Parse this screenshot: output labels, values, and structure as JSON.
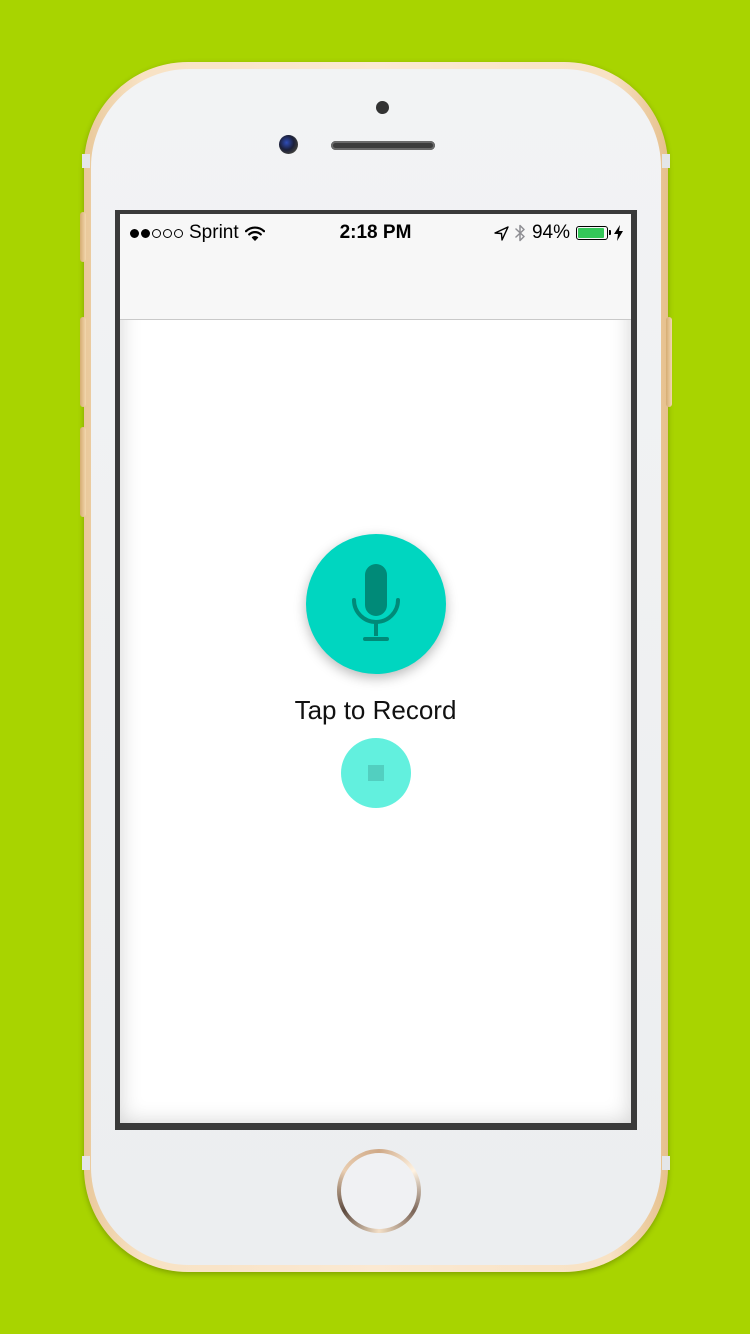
{
  "status_bar": {
    "signal_filled": 2,
    "signal_total": 5,
    "carrier": "Sprint",
    "time": "2:18 PM",
    "battery_percent": "94%",
    "battery_level": 0.94
  },
  "nav_bar": {
    "title": ""
  },
  "recorder": {
    "record_icon": "microphone-icon",
    "prompt": "Tap to Record",
    "stop_icon": "stop-icon"
  },
  "colors": {
    "background": "#a8d400",
    "record_accent": "#00d6c0",
    "stop_accent": "#62f0de",
    "battery": "#34c759"
  }
}
